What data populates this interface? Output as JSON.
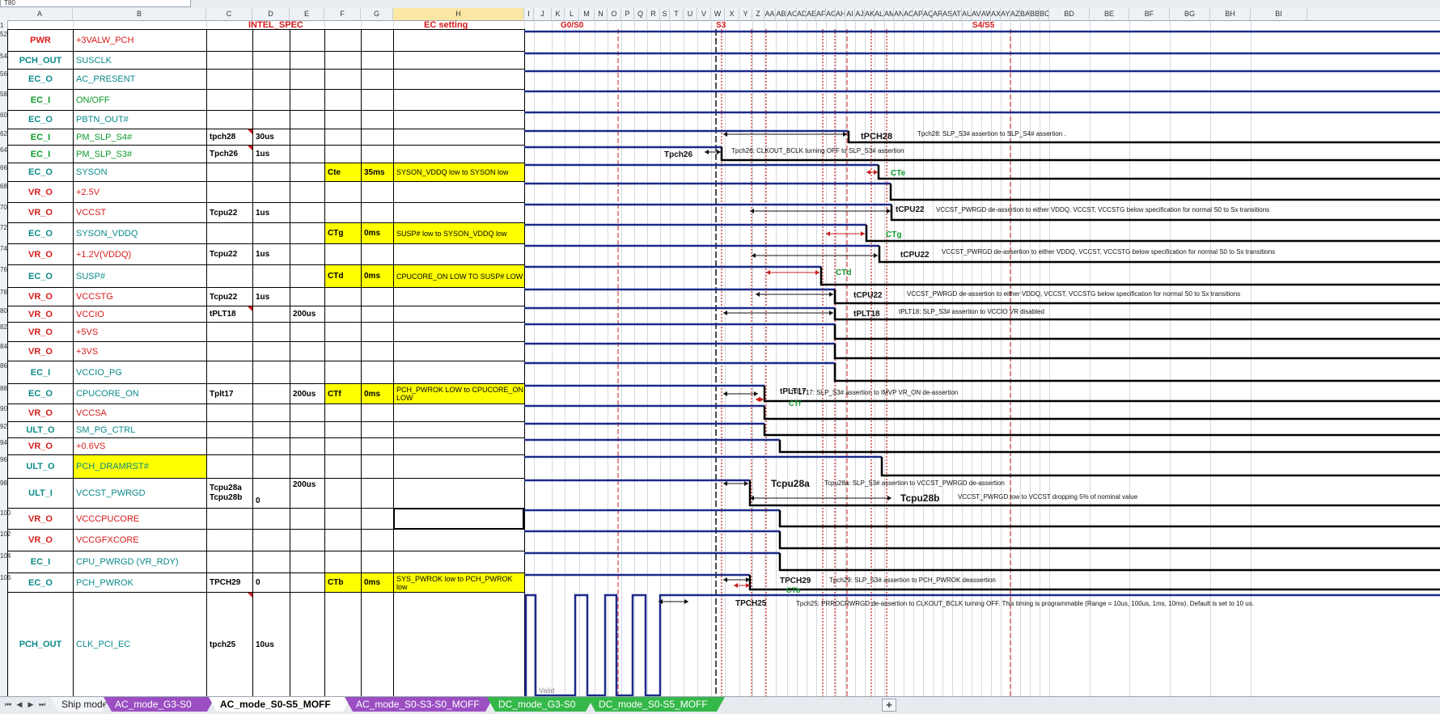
{
  "app": {
    "name_box": "T80"
  },
  "columns": [
    "A",
    "B",
    "C",
    "D",
    "E",
    "F",
    "G",
    "H",
    "I",
    "J",
    "K",
    "L",
    "M",
    "N",
    "O",
    "P",
    "Q",
    "R",
    "S",
    "T",
    "U",
    "V",
    "W",
    "X",
    "Y",
    "Z",
    "AA",
    "AB",
    "AC",
    "AD",
    "AE",
    "AF",
    "AG",
    "AH",
    "AI",
    "AJ",
    "AK",
    "AL",
    "AM",
    "AN",
    "AO",
    "AP",
    "AQ",
    "AR",
    "AS",
    "AT",
    "AU",
    "AV",
    "AW",
    "AX",
    "AY",
    "AZ",
    "BA",
    "BB",
    "BC",
    "BD",
    "BE",
    "BF",
    "BG",
    "BH",
    "BI"
  ],
  "selected_column": "H",
  "headers": {
    "intel_spec": "INTEL_SPEC",
    "ec_setting": "EC setting",
    "state_g0s0": "G0/S0",
    "state_s3": "S3",
    "state_s4s5": "S4/S5"
  },
  "row_numbers": [
    "1",
    "52",
    "54",
    "56",
    "58",
    "60",
    "62",
    "64",
    "66",
    "68",
    "70",
    "72",
    "74",
    "76",
    "78",
    "80",
    "82",
    "84",
    "86",
    "88",
    "90",
    "92",
    "94",
    "96",
    "98",
    "100",
    "102",
    "104",
    "106"
  ],
  "rows": [
    {
      "type": "PWR",
      "signal": "+3VALW_PCH",
      "param": "",
      "value": "",
      "value2": "",
      "ec_param": "",
      "ec_value": "",
      "ec_desc": "",
      "type_color": "red",
      "signal_color": "red"
    },
    {
      "type": "PCH_OUT",
      "signal": "SUSCLK",
      "param": "",
      "value": "",
      "value2": "",
      "ec_param": "",
      "ec_value": "",
      "ec_desc": "",
      "type_color": "teal",
      "signal_color": "teal"
    },
    {
      "type": "EC_O",
      "signal": "AC_PRESENT",
      "param": "",
      "value": "",
      "value2": "",
      "ec_param": "",
      "ec_value": "",
      "ec_desc": "",
      "type_color": "teal",
      "signal_color": "teal"
    },
    {
      "type": "EC_I",
      "signal": "ON/OFF",
      "param": "",
      "value": "",
      "value2": "",
      "ec_param": "",
      "ec_value": "",
      "ec_desc": "",
      "type_color": "green",
      "signal_color": "green"
    },
    {
      "type": "EC_O",
      "signal": "PBTN_OUT#",
      "param": "",
      "value": "",
      "value2": "",
      "ec_param": "",
      "ec_value": "",
      "ec_desc": "",
      "type_color": "teal",
      "signal_color": "teal"
    },
    {
      "type": "EC_I",
      "signal": "PM_SLP_S4#",
      "param": "tpch28",
      "value": "30us",
      "value2": "",
      "ec_param": "",
      "ec_value": "",
      "ec_desc": "",
      "type_color": "green",
      "signal_color": "green"
    },
    {
      "type": "EC_I",
      "signal": "PM_SLP_S3#",
      "param": "Tpch26",
      "value": "1us",
      "value2": "",
      "ec_param": "",
      "ec_value": "",
      "ec_desc": "",
      "type_color": "green",
      "signal_color": "green"
    },
    {
      "type": "EC_O",
      "signal": "SYSON",
      "param": "",
      "value": "",
      "value2": "",
      "ec_param": "Cte",
      "ec_value": "35ms",
      "ec_desc": "SYSON_VDDQ low to SYSON low",
      "type_color": "teal",
      "signal_color": "teal"
    },
    {
      "type": "VR_O",
      "signal": "+2.5V",
      "param": "",
      "value": "",
      "value2": "",
      "ec_param": "",
      "ec_value": "",
      "ec_desc": "",
      "type_color": "red",
      "signal_color": "red"
    },
    {
      "type": "VR_O",
      "signal": "VCCST",
      "param": "Tcpu22",
      "value": "1us",
      "value2": "",
      "ec_param": "",
      "ec_value": "",
      "ec_desc": "",
      "type_color": "red",
      "signal_color": "red"
    },
    {
      "type": "EC_O",
      "signal": "SYSON_VDDQ",
      "param": "",
      "value": "",
      "value2": "",
      "ec_param": "CTg",
      "ec_value": "0ms",
      "ec_desc": "SUSP# low to SYSON_VDDQ low",
      "type_color": "teal",
      "signal_color": "teal"
    },
    {
      "type": "VR_O",
      "signal": "+1.2V(VDDQ)",
      "param": "Tcpu22",
      "value": "1us",
      "value2": "",
      "ec_param": "",
      "ec_value": "",
      "ec_desc": "",
      "type_color": "red",
      "signal_color": "red"
    },
    {
      "type": "EC_O",
      "signal": "SUSP#",
      "param": "",
      "value": "",
      "value2": "",
      "ec_param": "CTd",
      "ec_value": "0ms",
      "ec_desc": "CPUCORE_ON LOW TO SUSP# LOW",
      "type_color": "teal",
      "signal_color": "teal"
    },
    {
      "type": "VR_O",
      "signal": "VCCSTG",
      "param": "Tcpu22",
      "value": "1us",
      "value2": "",
      "ec_param": "",
      "ec_value": "",
      "ec_desc": "",
      "type_color": "red",
      "signal_color": "red"
    },
    {
      "type": "VR_O",
      "signal": "VCCIO",
      "param": "tPLT18",
      "value": "",
      "value2": "200us",
      "ec_param": "",
      "ec_value": "",
      "ec_desc": "",
      "type_color": "red",
      "signal_color": "red"
    },
    {
      "type": "VR_O",
      "signal": "+5VS",
      "param": "",
      "value": "",
      "value2": "",
      "ec_param": "",
      "ec_value": "",
      "ec_desc": "",
      "type_color": "red",
      "signal_color": "red"
    },
    {
      "type": "VR_O",
      "signal": "+3VS",
      "param": "",
      "value": "",
      "value2": "",
      "ec_param": "",
      "ec_value": "",
      "ec_desc": "",
      "type_color": "red",
      "signal_color": "red"
    },
    {
      "type": "EC_I",
      "signal": "VCCIO_PG",
      "param": "",
      "value": "",
      "value2": "",
      "ec_param": "",
      "ec_value": "",
      "ec_desc": "",
      "type_color": "teal",
      "signal_color": "teal"
    },
    {
      "type": "EC_O",
      "signal": "CPUCORE_ON",
      "param": "Tplt17",
      "value": "",
      "value2": "200us",
      "ec_param": "CTf",
      "ec_value": "0ms",
      "ec_desc": "PCH_PWROK LOW to CPUCORE_ON LOW",
      "type_color": "teal",
      "signal_color": "teal"
    },
    {
      "type": "VR_O",
      "signal": "VCCSA",
      "param": "",
      "value": "",
      "value2": "",
      "ec_param": "",
      "ec_value": "",
      "ec_desc": "",
      "type_color": "red",
      "signal_color": "red"
    },
    {
      "type": "ULT_O",
      "signal": "SM_PG_CTRL",
      "param": "",
      "value": "",
      "value2": "",
      "ec_param": "",
      "ec_value": "",
      "ec_desc": "",
      "type_color": "teal",
      "signal_color": "teal"
    },
    {
      "type": "VR_O",
      "signal": "+0.6VS",
      "param": "",
      "value": "",
      "value2": "",
      "ec_param": "",
      "ec_value": "",
      "ec_desc": "",
      "type_color": "red",
      "signal_color": "red"
    },
    {
      "type": "ULT_O",
      "signal": "PCH_DRAMRST#",
      "param": "",
      "value": "",
      "value2": "",
      "ec_param": "",
      "ec_value": "",
      "ec_desc": "",
      "type_color": "teal",
      "signal_color": "teal"
    },
    {
      "type": "ULT_I",
      "signal": "VCCST_PWRGD",
      "param": "Tcpu28a\nTcpu28b",
      "value": "0",
      "value2": "200us",
      "ec_param": "",
      "ec_value": "",
      "ec_desc": "",
      "type_color": "teal",
      "signal_color": "teal"
    },
    {
      "type": "VR_O",
      "signal": "VCCCPUCORE",
      "param": "",
      "value": "",
      "value2": "",
      "ec_param": "",
      "ec_value": "",
      "ec_desc": "",
      "type_color": "red",
      "signal_color": "red"
    },
    {
      "type": "VR_O",
      "signal": "VCCGFXCORE",
      "param": "",
      "value": "",
      "value2": "",
      "ec_param": "",
      "ec_value": "",
      "ec_desc": "",
      "type_color": "red",
      "signal_color": "red"
    },
    {
      "type": "EC_I",
      "signal": "CPU_PWRGD (VR_RDY)",
      "param": "",
      "value": "",
      "value2": "",
      "ec_param": "",
      "ec_value": "",
      "ec_desc": "",
      "type_color": "teal",
      "signal_color": "teal"
    },
    {
      "type": "EC_O",
      "signal": "PCH_PWROK",
      "param": "TPCH29",
      "value": "0",
      "value2": "",
      "ec_param": "CTb",
      "ec_value": "0ms",
      "ec_desc": "SYS_PWROK low to PCH_PWROK low",
      "type_color": "teal",
      "signal_color": "teal"
    },
    {
      "type": "PCH_OUT",
      "signal": "CLK_PCI_EC",
      "param": "tpch25",
      "value": "10us",
      "value2": "",
      "ec_param": "",
      "ec_value": "",
      "ec_desc": "",
      "type_color": "teal",
      "signal_color": "teal"
    }
  ],
  "timing_labels": [
    {
      "id": "tpch28",
      "label": "tPCH28",
      "desc": "Tpch28: SLP_S3# assertion to SLP_S4# assertion ."
    },
    {
      "id": "tpch26",
      "label": "Tpch26",
      "desc": "Tpch26: CLKOUT_BCLK turning OFF to SLP_S3# assertion"
    },
    {
      "id": "cte",
      "label": "CTe",
      "desc": ""
    },
    {
      "id": "tcpu22a",
      "label": "tCPU22",
      "desc": "VCCST_PWRGD de-assertion to either VDDQ, VCCST, VCCSTG below specification for normal S0 to Sx transitions"
    },
    {
      "id": "ctg",
      "label": "CTg",
      "desc": ""
    },
    {
      "id": "tcpu22b",
      "label": "tCPU22",
      "desc": "VCCST_PWRGD de-assertion to either VDDQ, VCCST, VCCSTG below specification for normal S0 to Sx transitions"
    },
    {
      "id": "ctd",
      "label": "CTd",
      "desc": ""
    },
    {
      "id": "tcpu22c",
      "label": "tCPU22",
      "desc": "VCCST_PWRGD de-assertion to either VDDQ, VCCST, VCCSTG below specification for normal S0 to Sx transitions"
    },
    {
      "id": "tplt18",
      "label": "tPLT18",
      "desc": "tPLT18: SLP_S3# assertion to VCCIO VR disabled"
    },
    {
      "id": "tplt17",
      "label": "tPLT17",
      "desc": "TPLT17: SLP_S3# assertion to IMVP VR_ON de-assertion"
    },
    {
      "id": "ctf",
      "label": "CTf",
      "desc": ""
    },
    {
      "id": "tcpu28a",
      "label": "Tcpu28a",
      "desc": "Tcpu28a: SLP_S3# assertion to VCCST_PWRGD de-assertion"
    },
    {
      "id": "tcpu28b",
      "label": "Tcpu28b",
      "desc": "VCCST_PWRGD low to VCCST dropping 5% of nominal value"
    },
    {
      "id": "tpch29",
      "label": "TPCH29",
      "desc": "Tpch29: SLP_S3# assertion to PCH_PWROK deassertion"
    },
    {
      "id": "ctb",
      "label": "CTb",
      "desc": ""
    },
    {
      "id": "tpch25",
      "label": "TPCH25",
      "desc": "Tpch25: PRROCRWRGD de-assertion to CLKOUT_BCLK turning OFF. This timing is programmable (Range = 10us, 100us, 1ms, 10ms). Default is set to 10 us."
    }
  ],
  "clk_valid_label": "Valid",
  "tabs": [
    {
      "label": "Ship mode",
      "color": "#e7ebf0",
      "active": false
    },
    {
      "label": "AC_mode_G3-S0",
      "color": "#9b4fc3",
      "active": false
    },
    {
      "label": "AC_mode_S0-S5_MOFF",
      "color": "#ffffff",
      "active": true
    },
    {
      "label": "AC_mode_S0-S3-S0_MOFF",
      "color": "#9b4fc3",
      "active": false
    },
    {
      "label": "DC_mode_G3-S0",
      "color": "#35b84a",
      "active": false
    },
    {
      "label": "DC_mode_S0-S5_MOFF",
      "color": "#35b84a",
      "active": false
    }
  ],
  "colors": {
    "wave": "#1c2a8a",
    "wave_low": "#000000",
    "marker": "#c81e1e",
    "arrow": "#111111",
    "highlight": "#ffff00"
  }
}
